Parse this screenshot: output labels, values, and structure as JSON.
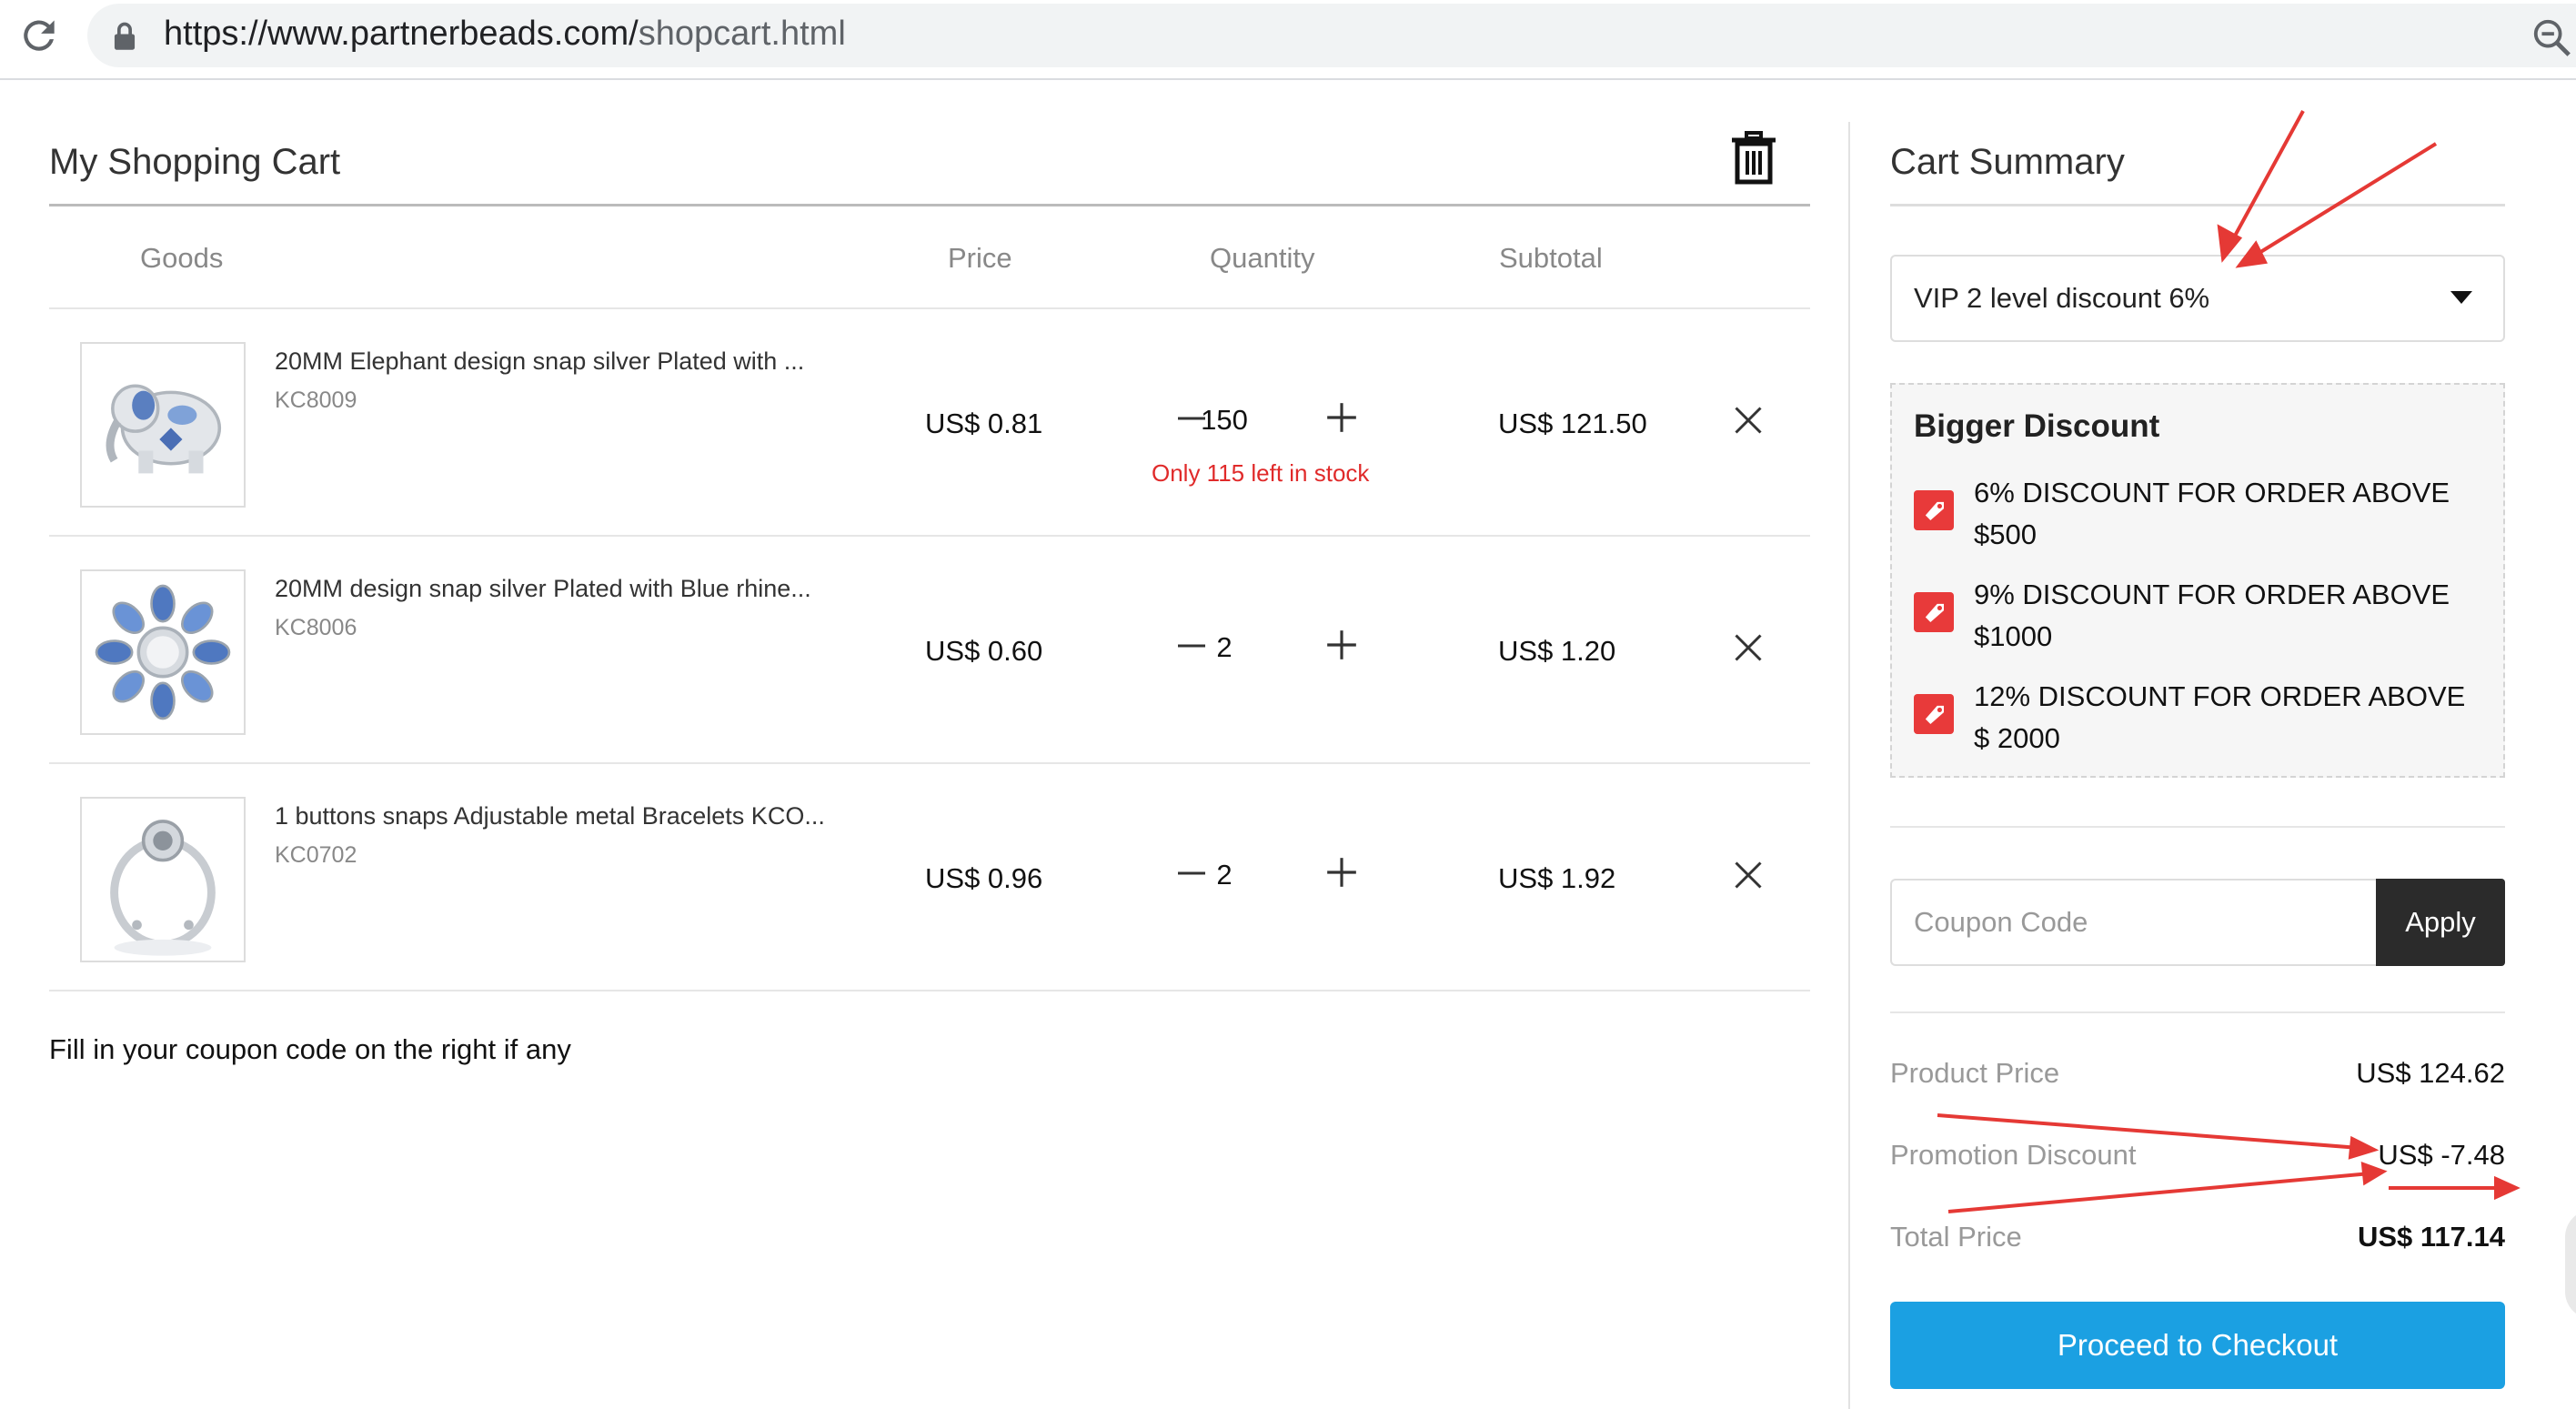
{
  "browser": {
    "url_domain": "https://www.partnerbeads.com/",
    "url_path": "shopcart.html"
  },
  "cart": {
    "title": "My Shopping Cart",
    "columns": {
      "goods": "Goods",
      "price": "Price",
      "quantity": "Quantity",
      "subtotal": "Subtotal"
    },
    "items": [
      {
        "name": "20MM Elephant design snap silver Plated with ...",
        "sku": "KC8009",
        "price": "US$ 0.81",
        "quantity": "150",
        "stock_note": "Only 115 left in stock",
        "subtotal": "US$ 121.50"
      },
      {
        "name": "20MM design snap silver Plated with Blue rhine...",
        "sku": "KC8006",
        "price": "US$ 0.60",
        "quantity": "2",
        "stock_note": "",
        "subtotal": "US$ 1.20"
      },
      {
        "name": "1 buttons snaps Adjustable metal Bracelets KCO...",
        "sku": "KC0702",
        "price": "US$ 0.96",
        "quantity": "2",
        "stock_note": "",
        "subtotal": "US$ 1.92"
      }
    ],
    "hint": "Fill in your coupon code on the right if any"
  },
  "summary": {
    "title": "Cart Summary",
    "vip_select": "VIP 2 level discount 6%",
    "bigger_discount": {
      "title": "Bigger Discount",
      "tiers": [
        "6% DISCOUNT FOR ORDER ABOVE $500",
        "9% DISCOUNT FOR ORDER ABOVE $1000",
        "12% DISCOUNT FOR ORDER ABOVE $ 2000"
      ]
    },
    "coupon_placeholder": "Coupon Code",
    "apply_label": "Apply",
    "product_price_label": "Product Price",
    "product_price": "US$ 124.62",
    "promotion_label": "Promotion Discount",
    "promotion_value": "US$ -7.48",
    "total_label": "Total Price",
    "total_value": "US$ 117.14",
    "checkout_label": "Proceed to Checkout"
  },
  "colors": {
    "accent": "#1ba0e2",
    "warning": "#e02a2a",
    "annotation": "#e53935",
    "apply_bg": "#2b2b2b"
  },
  "icons": [
    "reload-icon",
    "lock-icon",
    "zoom-icon",
    "star-icon",
    "trash-icon",
    "minus-icon",
    "plus-icon",
    "close-icon",
    "caret-down-icon",
    "tag-icon"
  ]
}
